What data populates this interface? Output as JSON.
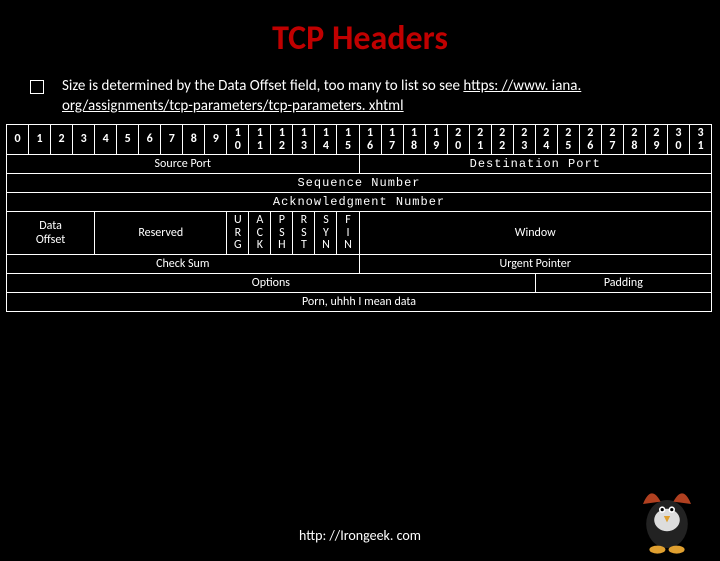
{
  "title": "TCP Headers",
  "bullet": {
    "text": "Size is determined by the Data Offset field, too many to list so see ",
    "link_text": "https: //www. iana. org/assignments/tcp-parameters/tcp-parameters. xhtml"
  },
  "bits": [
    "0",
    "1",
    "2",
    "3",
    "4",
    "5",
    "6",
    "7",
    "8",
    "9",
    "1\n0",
    "1\n1",
    "1\n2",
    "1\n3",
    "1\n4",
    "1\n5",
    "1\n6",
    "1\n7",
    "1\n8",
    "1\n9",
    "2\n0",
    "2\n1",
    "2\n2",
    "2\n3",
    "2\n4",
    "2\n5",
    "2\n6",
    "2\n7",
    "2\n8",
    "2\n9",
    "3\n0",
    "3\n1"
  ],
  "rows": {
    "src_port": "Source Port",
    "dst_port": "Destination Port",
    "seq": "Sequence Number",
    "ack": "Acknowledgment Number",
    "data_offset": "Data\nOffset",
    "reserved": "Reserved",
    "flags": [
      "U\nR\nG",
      "A\nC\nK",
      "P\nS\nH",
      "R\nS\nT",
      "S\nY\nN",
      "F\nI\nN"
    ],
    "window": "Window",
    "checksum": "Check Sum",
    "urgent": "Urgent Pointer",
    "options": "Options",
    "padding": "Padding",
    "data": "Porn, uhhh I mean data"
  },
  "footer": "http: //Irongeek. com"
}
